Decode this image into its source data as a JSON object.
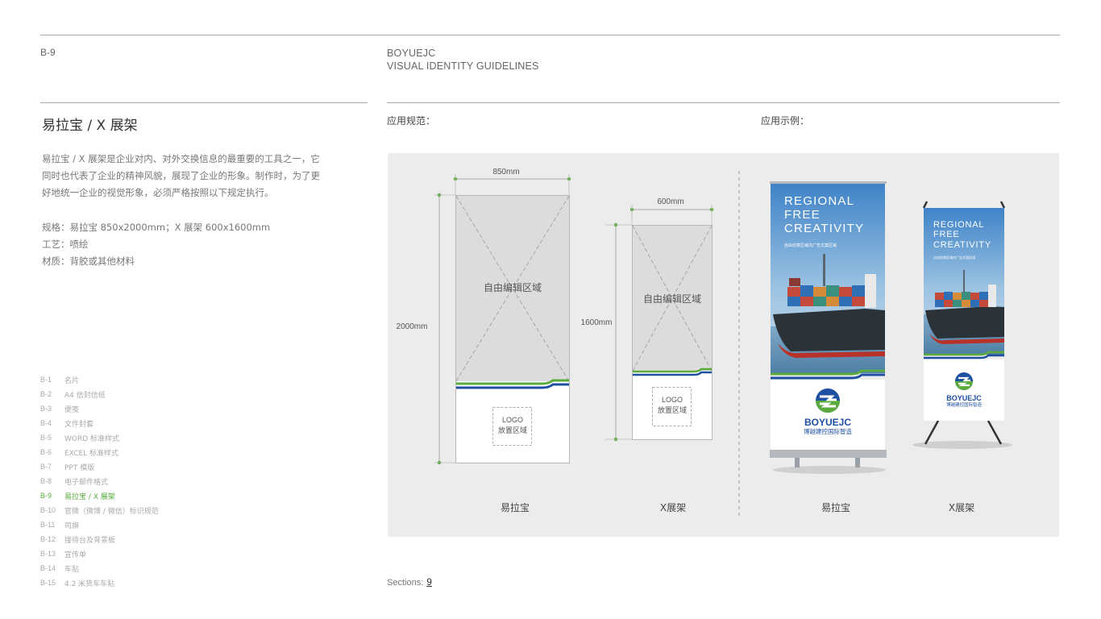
{
  "header": {
    "code": "B-9",
    "brand_line1": "BOYUEJC",
    "brand_line2": "VISUAL IDENTITY GUIDELINES"
  },
  "section": {
    "title": "易拉宝 / X 展架",
    "intro": "易拉宝 / X 展架是企业对内、对外交换信息的最重要的工具之一，它同时也代表了企业的精神风貌，展现了企业的形象。制作时，为了更好地统一企业的视觉形象，必须严格按照以下规定执行。",
    "spec_size": "规格：易拉宝 850x2000mm；X 展架 600x1600mm",
    "spec_process": "工艺：喷绘",
    "spec_material": "材质：背胶或其他材料"
  },
  "nav": [
    {
      "code": "B-1",
      "label": "名片",
      "active": false
    },
    {
      "code": "B-2",
      "label": "A4 信封信纸",
      "active": false
    },
    {
      "code": "B-3",
      "label": "便笺",
      "active": false
    },
    {
      "code": "B-4",
      "label": "文件封套",
      "active": false
    },
    {
      "code": "B-5",
      "label": "WORD 标准样式",
      "active": false
    },
    {
      "code": "B-6",
      "label": "EXCEL 标准样式",
      "active": false
    },
    {
      "code": "B-7",
      "label": "PPT 模版",
      "active": false
    },
    {
      "code": "B-8",
      "label": "电子邮件格式",
      "active": false
    },
    {
      "code": "B-9",
      "label": "易拉宝 / X 展架",
      "active": true
    },
    {
      "code": "B-10",
      "label": "官微（微博 / 微信）标识规范",
      "active": false
    },
    {
      "code": "B-11",
      "label": "司旗",
      "active": false
    },
    {
      "code": "B-12",
      "label": "接待台及背景板",
      "active": false
    },
    {
      "code": "B-13",
      "label": "宣传单",
      "active": false
    },
    {
      "code": "B-14",
      "label": "车贴",
      "active": false
    },
    {
      "code": "B-15",
      "label": "4.2 米货车车贴",
      "active": false
    }
  ],
  "labels": {
    "spec": "应用规范：",
    "example": "应用示例："
  },
  "diagram": {
    "rollup_width": "850mm",
    "rollup_height": "2000mm",
    "xstand_width": "600mm",
    "xstand_height": "1600mm",
    "edit_area": "自由编辑区域",
    "logo_line1": "LOGO",
    "logo_line2": "放置区域"
  },
  "banner": {
    "slogan_line1": "REGIONAL",
    "slogan_line2": "FREE",
    "slogan_line3": "CREATIVITY",
    "tagline": "自由创意区域内广告文案区域",
    "logo_text": "BOYUEJC",
    "logo_cn": "博越建控国际智造"
  },
  "captions": {
    "rollup": "易拉宝",
    "xstand": "X展架",
    "rollup_example": "易拉宝",
    "xstand_example": "X展架"
  },
  "footer": {
    "label": "Sections:",
    "number": "9"
  },
  "colors": {
    "accent_green": "#5aaa3c",
    "accent_blue": "#1e4fa0",
    "panel_bg": "#ececed"
  }
}
